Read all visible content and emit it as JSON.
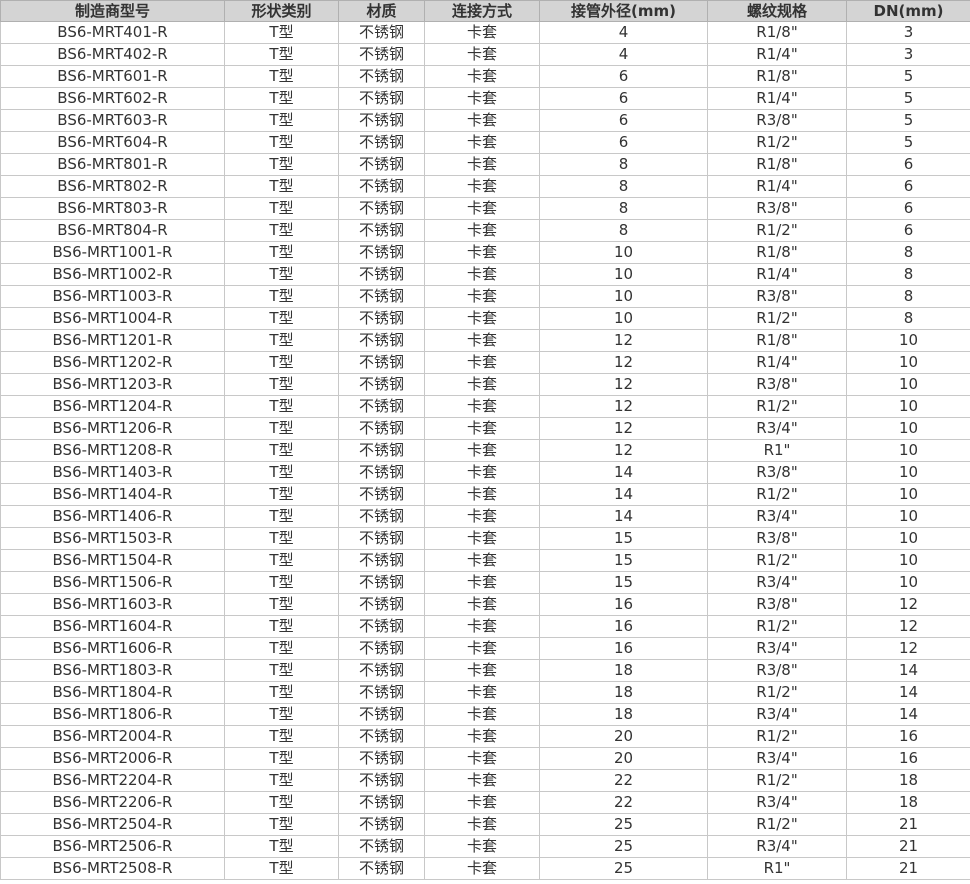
{
  "table": {
    "headers": [
      "制造商型号",
      "形状类别",
      "材质",
      "连接方式",
      "接管外径(mm)",
      "螺纹规格",
      "DN(mm)"
    ],
    "rows": [
      [
        "BS6-MRT401-R",
        "T型",
        "不锈钢",
        "卡套",
        "4",
        "R1/8\"",
        "3"
      ],
      [
        "BS6-MRT402-R",
        "T型",
        "不锈钢",
        "卡套",
        "4",
        "R1/4\"",
        "3"
      ],
      [
        "BS6-MRT601-R",
        "T型",
        "不锈钢",
        "卡套",
        "6",
        "R1/8\"",
        "5"
      ],
      [
        "BS6-MRT602-R",
        "T型",
        "不锈钢",
        "卡套",
        "6",
        "R1/4\"",
        "5"
      ],
      [
        "BS6-MRT603-R",
        "T型",
        "不锈钢",
        "卡套",
        "6",
        "R3/8\"",
        "5"
      ],
      [
        "BS6-MRT604-R",
        "T型",
        "不锈钢",
        "卡套",
        "6",
        "R1/2\"",
        "5"
      ],
      [
        "BS6-MRT801-R",
        "T型",
        "不锈钢",
        "卡套",
        "8",
        "R1/8\"",
        "6"
      ],
      [
        "BS6-MRT802-R",
        "T型",
        "不锈钢",
        "卡套",
        "8",
        "R1/4\"",
        "6"
      ],
      [
        "BS6-MRT803-R",
        "T型",
        "不锈钢",
        "卡套",
        "8",
        "R3/8\"",
        "6"
      ],
      [
        "BS6-MRT804-R",
        "T型",
        "不锈钢",
        "卡套",
        "8",
        "R1/2\"",
        "6"
      ],
      [
        "BS6-MRT1001-R",
        "T型",
        "不锈钢",
        "卡套",
        "10",
        "R1/8\"",
        "8"
      ],
      [
        "BS6-MRT1002-R",
        "T型",
        "不锈钢",
        "卡套",
        "10",
        "R1/4\"",
        "8"
      ],
      [
        "BS6-MRT1003-R",
        "T型",
        "不锈钢",
        "卡套",
        "10",
        "R3/8\"",
        "8"
      ],
      [
        "BS6-MRT1004-R",
        "T型",
        "不锈钢",
        "卡套",
        "10",
        "R1/2\"",
        "8"
      ],
      [
        "BS6-MRT1201-R",
        "T型",
        "不锈钢",
        "卡套",
        "12",
        "R1/8\"",
        "10"
      ],
      [
        "BS6-MRT1202-R",
        "T型",
        "不锈钢",
        "卡套",
        "12",
        "R1/4\"",
        "10"
      ],
      [
        "BS6-MRT1203-R",
        "T型",
        "不锈钢",
        "卡套",
        "12",
        "R3/8\"",
        "10"
      ],
      [
        "BS6-MRT1204-R",
        "T型",
        "不锈钢",
        "卡套",
        "12",
        "R1/2\"",
        "10"
      ],
      [
        "BS6-MRT1206-R",
        "T型",
        "不锈钢",
        "卡套",
        "12",
        "R3/4\"",
        "10"
      ],
      [
        "BS6-MRT1208-R",
        "T型",
        "不锈钢",
        "卡套",
        "12",
        "R1\"",
        "10"
      ],
      [
        "BS6-MRT1403-R",
        "T型",
        "不锈钢",
        "卡套",
        "14",
        "R3/8\"",
        "10"
      ],
      [
        "BS6-MRT1404-R",
        "T型",
        "不锈钢",
        "卡套",
        "14",
        "R1/2\"",
        "10"
      ],
      [
        "BS6-MRT1406-R",
        "T型",
        "不锈钢",
        "卡套",
        "14",
        "R3/4\"",
        "10"
      ],
      [
        "BS6-MRT1503-R",
        "T型",
        "不锈钢",
        "卡套",
        "15",
        "R3/8\"",
        "10"
      ],
      [
        "BS6-MRT1504-R",
        "T型",
        "不锈钢",
        "卡套",
        "15",
        "R1/2\"",
        "10"
      ],
      [
        "BS6-MRT1506-R",
        "T型",
        "不锈钢",
        "卡套",
        "15",
        "R3/4\"",
        "10"
      ],
      [
        "BS6-MRT1603-R",
        "T型",
        "不锈钢",
        "卡套",
        "16",
        "R3/8\"",
        "12"
      ],
      [
        "BS6-MRT1604-R",
        "T型",
        "不锈钢",
        "卡套",
        "16",
        "R1/2\"",
        "12"
      ],
      [
        "BS6-MRT1606-R",
        "T型",
        "不锈钢",
        "卡套",
        "16",
        "R3/4\"",
        "12"
      ],
      [
        "BS6-MRT1803-R",
        "T型",
        "不锈钢",
        "卡套",
        "18",
        "R3/8\"",
        "14"
      ],
      [
        "BS6-MRT1804-R",
        "T型",
        "不锈钢",
        "卡套",
        "18",
        "R1/2\"",
        "14"
      ],
      [
        "BS6-MRT1806-R",
        "T型",
        "不锈钢",
        "卡套",
        "18",
        "R3/4\"",
        "14"
      ],
      [
        "BS6-MRT2004-R",
        "T型",
        "不锈钢",
        "卡套",
        "20",
        "R1/2\"",
        "16"
      ],
      [
        "BS6-MRT2006-R",
        "T型",
        "不锈钢",
        "卡套",
        "20",
        "R3/4\"",
        "16"
      ],
      [
        "BS6-MRT2204-R",
        "T型",
        "不锈钢",
        "卡套",
        "22",
        "R1/2\"",
        "18"
      ],
      [
        "BS6-MRT2206-R",
        "T型",
        "不锈钢",
        "卡套",
        "22",
        "R3/4\"",
        "18"
      ],
      [
        "BS6-MRT2504-R",
        "T型",
        "不锈钢",
        "卡套",
        "25",
        "R1/2\"",
        "21"
      ],
      [
        "BS6-MRT2506-R",
        "T型",
        "不锈钢",
        "卡套",
        "25",
        "R3/4\"",
        "21"
      ],
      [
        "BS6-MRT2508-R",
        "T型",
        "不锈钢",
        "卡套",
        "25",
        "R1\"",
        "21"
      ]
    ]
  },
  "colors": {
    "header_background": "#d4d4d4",
    "text": "#333333",
    "border": "#c8c8c8"
  }
}
